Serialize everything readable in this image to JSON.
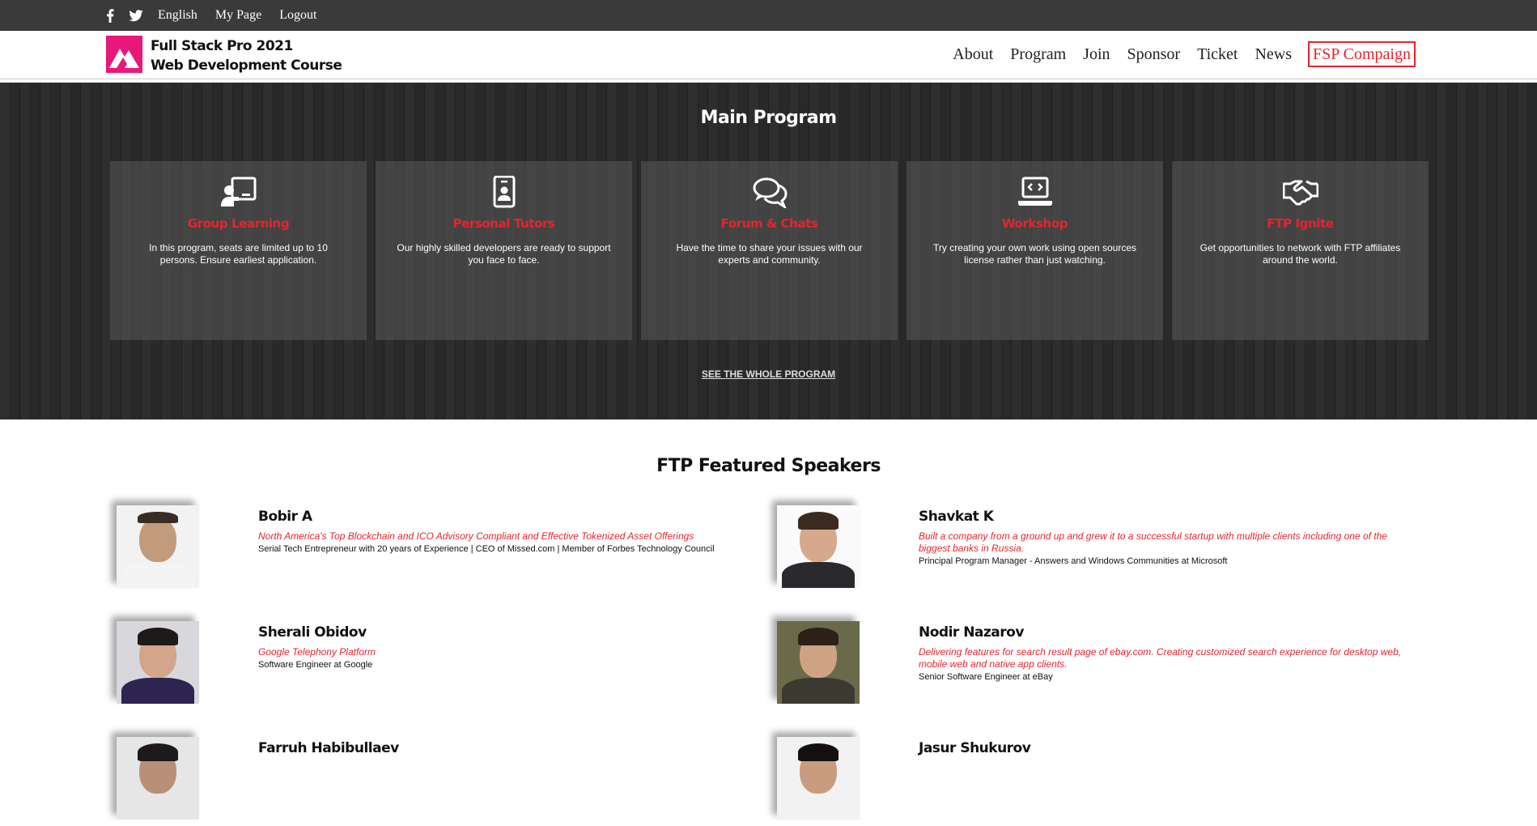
{
  "topbar": {
    "icons": [
      "facebook-icon",
      "twitter-icon"
    ],
    "links": [
      "English",
      "My Page",
      "Logout"
    ]
  },
  "header": {
    "brand_line1": "Full Stack Pro 2021",
    "brand_line2": "Web Development Course",
    "nav": [
      "About",
      "Program",
      "Join",
      "Sponsor",
      "Ticket",
      "News"
    ],
    "cta": "FSP Compaign"
  },
  "program": {
    "title": "Main Program",
    "cards": [
      {
        "icon": "teacher-board-icon",
        "title": "Group Learning",
        "text": "In this program, seats are limited up to 10 persons. Ensure earliest application."
      },
      {
        "icon": "id-badge-icon",
        "title": "Personal Tutors",
        "text": "Our highly skilled developers are ready to support you face to face."
      },
      {
        "icon": "chat-bubbles-icon",
        "title": "Forum & Chats",
        "text": "Have the time to share your issues with our experts and community."
      },
      {
        "icon": "laptop-code-icon",
        "title": "Workshop",
        "text": "Try creating your own work using open sources license rather than just watching."
      },
      {
        "icon": "handshake-icon",
        "title": "FTP Ignite",
        "text": "Get opportunities to network with FTP affiliates around the world."
      }
    ],
    "see_all": "SEE THE WHOLE PROGRAM"
  },
  "speakers": {
    "title": "FTP Featured Speakers",
    "items": [
      {
        "name": "Bobir A",
        "tagline": "North America's Top Blockchain and ICO Advisory Compliant and Effective Tokenized Asset Offerings",
        "role": "Serial Tech Entrepreneur with 20 years of Experience | CEO of Missed.com | Member of Forbes Technology Council"
      },
      {
        "name": "Shavkat K",
        "tagline": "Built a company from a ground up and grew it to a successful startup with multiple clients including one of the biggest banks in Russia.",
        "role": "Principal Program Manager - Answers and Windows Communities at Microsoft"
      },
      {
        "name": "Sherali Obidov",
        "tagline": "Google Telephony Platform",
        "role": "Software Engineer at Google"
      },
      {
        "name": "Nodir Nazarov",
        "tagline": "Delivering features for search result page of ebay.com. Creating customized search experience for desktop web, mobile web and native app clients.",
        "role": "Senior Software Engineer at eBay"
      },
      {
        "name": "Farruh Habibullaev",
        "tagline": "",
        "role": ""
      },
      {
        "name": "Jasur Shukurov",
        "tagline": "",
        "role": ""
      }
    ]
  },
  "colors": {
    "accent": "#e0262f",
    "logo": "#e8177a",
    "topbar": "#3a3a3a",
    "program_bg": "#2a2a2a"
  }
}
